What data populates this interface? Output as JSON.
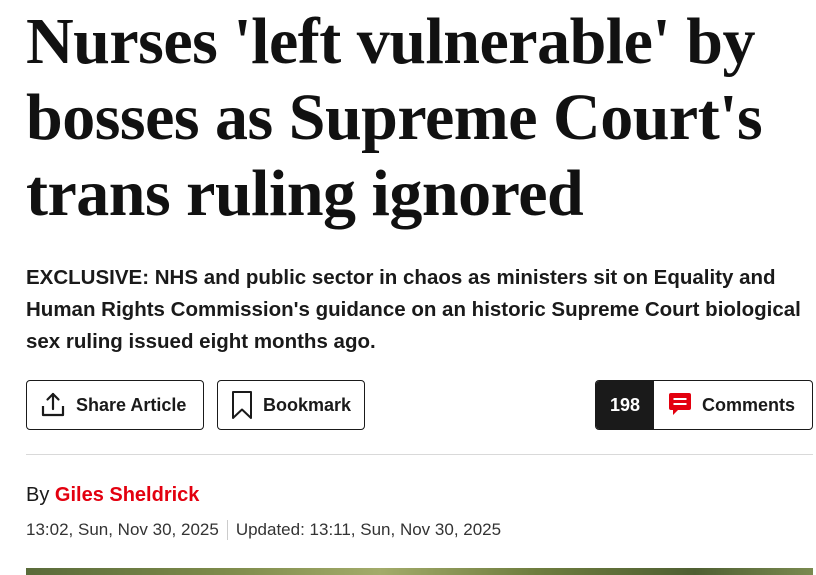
{
  "headline": "Nurses 'left vulnerable' by bosses as Supreme Court's trans ruling ignored",
  "standfirst": "EXCLUSIVE: NHS and public sector in chaos as ministers sit on Equality and Human Rights Commission's guidance on an historic Supreme Court biological sex ruling issued eight months ago.",
  "actions": {
    "share_label": "Share Article",
    "share_icon": "share-upload-icon",
    "bookmark_label": "Bookmark",
    "bookmark_icon": "bookmark-icon",
    "comment_count": "198",
    "comments_label": "Comments",
    "comments_icon": "speech-bubble-icon",
    "comments_icon_color": "#e3000f"
  },
  "byline": {
    "prefix": "By",
    "author": "Giles Sheldrick",
    "author_color": "#e3000f"
  },
  "dates": {
    "published": "13:02, Sun, Nov 30, 2025",
    "updated": "Updated: 13:11, Sun, Nov 30, 2025"
  }
}
